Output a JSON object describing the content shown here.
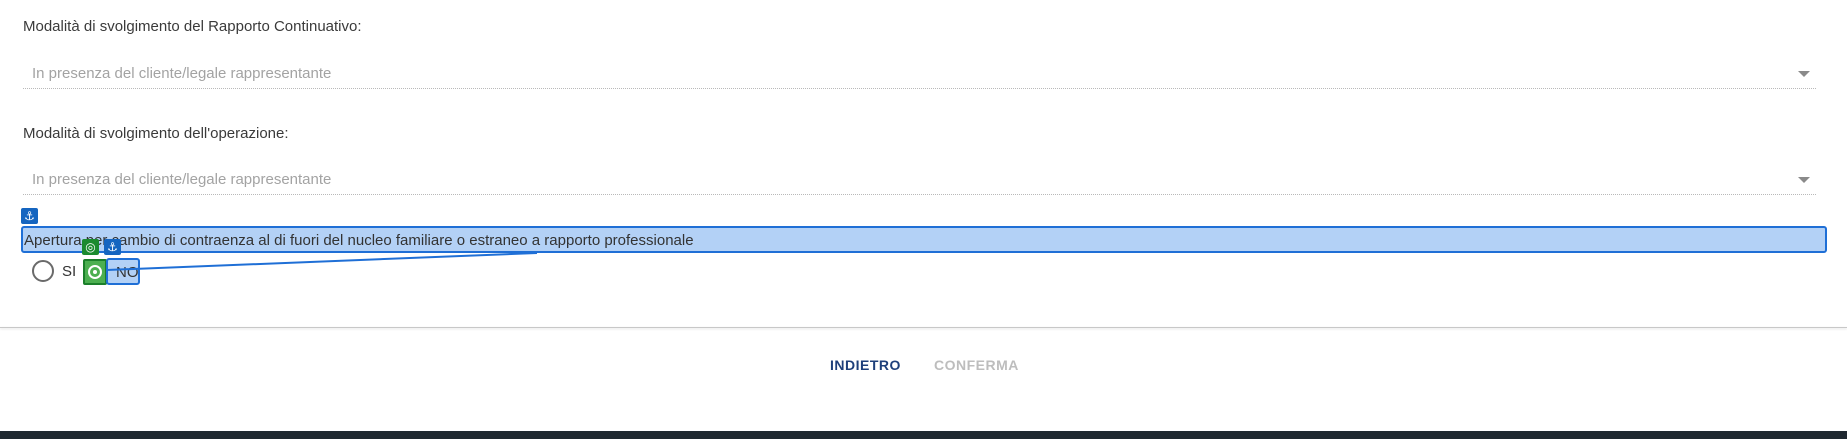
{
  "fields": [
    {
      "label": "Modalità di svolgimento del Rapporto Continuativo:",
      "value": "In presenza del cliente/legale rappresentante"
    },
    {
      "label": "Modalità di svolgimento dell'operazione:",
      "value": "In presenza del cliente/legale rappresentante"
    }
  ],
  "question": {
    "text": "Apertura per cambio di contraenza al di fuori del nucleo familiare o estraneo a rapporto professionale",
    "options": [
      "SI",
      "NO"
    ]
  },
  "overlay": {
    "anchor_icon": "⚓",
    "target_icon": "◎"
  },
  "actions": {
    "back_label": "INDIETRO",
    "confirm_label": "CONFERMA"
  },
  "colors": {
    "accent": "#1e3f7a",
    "overlay_blue": "#1f6fd6",
    "overlay_green": "#1b8a2f"
  }
}
